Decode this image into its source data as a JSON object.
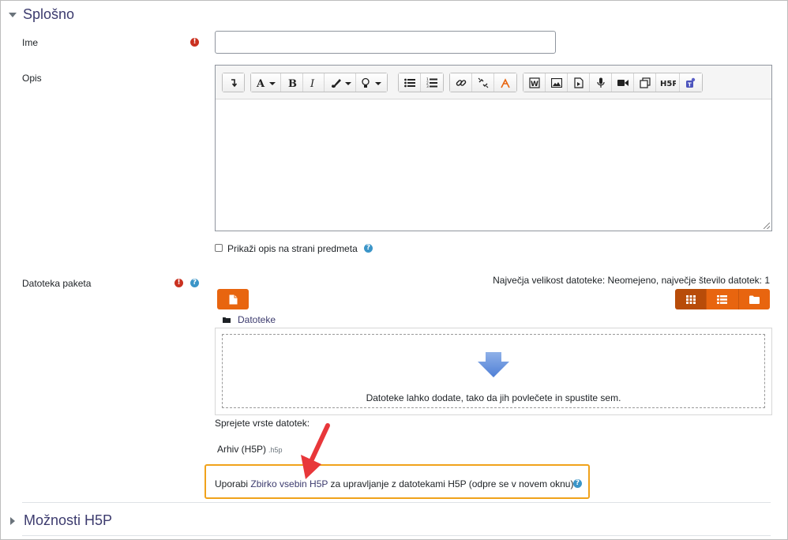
{
  "sections": {
    "general_title": "Splošno",
    "h5p_options_title": "Možnosti H5P"
  },
  "fields": {
    "name_label": "Ime",
    "name_value": "",
    "description_label": "Opis",
    "show_description_label": "Prikaži opis na strani predmeta",
    "package_file_label": "Datoteka paketa"
  },
  "filepicker": {
    "limits_text": "Največja velikost datoteke: Neomejeno, največje število datotek: 1",
    "path_folder": "Datoteke",
    "drop_text": "Datoteke lahko dodate, tako da jih povlečete in spustite sem.",
    "accepted_types_label": "Sprejete vrste datotek:",
    "file_type_name": "Arhiv (H5P)",
    "file_type_ext": ".h5p"
  },
  "content_bank_note": {
    "prefix": "Uporabi ",
    "link_text": "Zbirko vsebin H5P",
    "suffix": " za upravljanje z datotekami H5P (odpre se v novem oknu)"
  },
  "icons": {
    "required": "exclamation-circle-icon",
    "help": "question-circle-icon"
  },
  "colors": {
    "accent_orange": "#e8650f",
    "link": "#3c3b6e",
    "required_red": "#ca3120",
    "help_blue": "#3b95c8",
    "highlight_border": "#f0a21b",
    "arrow_red": "#e8373a"
  }
}
